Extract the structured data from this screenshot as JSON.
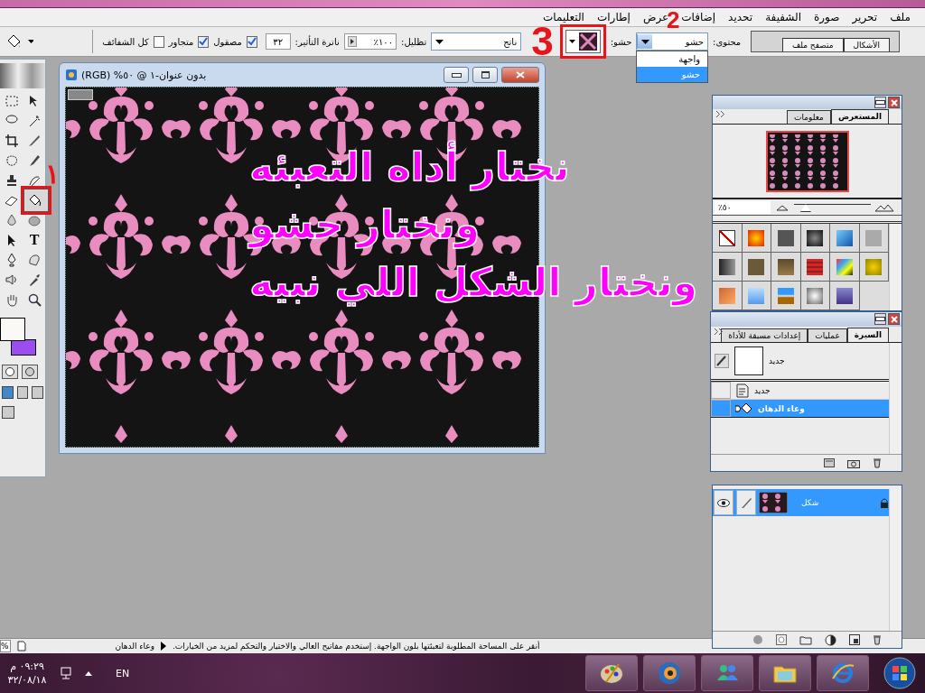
{
  "menu": [
    "ملف",
    "تحرير",
    "صورة",
    "الشفيفة",
    "تحديد",
    "إضافات",
    "عرض",
    "إطارات",
    "التعليمات"
  ],
  "options": {
    "well_tabs": [
      "الأشكال",
      "متصفح ملف"
    ],
    "content_label": "محتوى:",
    "content_value": "حشو",
    "content_options": [
      {
        "label": "واجهة",
        "selected": false
      },
      {
        "label": "حشو",
        "selected": true
      }
    ],
    "pattern_label": "حشو:",
    "mode_value": "ناتج",
    "opacity_label": "تظليل:",
    "opacity_value": "١٠٠٪",
    "tolerance_label": "ناترة التأثير:",
    "tolerance_value": "٣٢",
    "checkboxes": [
      {
        "label": "مصقول",
        "checked": true
      },
      {
        "label": "متجاور",
        "checked": true
      },
      {
        "label": "كل الشفائف",
        "checked": false
      }
    ]
  },
  "toolbox": {
    "tools": [
      {
        "kind": "marquee",
        "selected": false
      },
      {
        "kind": "move",
        "selected": false
      },
      {
        "kind": "lasso",
        "selected": false
      },
      {
        "kind": "wand",
        "selected": false
      },
      {
        "kind": "crop",
        "selected": false
      },
      {
        "kind": "knife",
        "selected": false
      },
      {
        "kind": "patch",
        "selected": false
      },
      {
        "kind": "brush",
        "selected": false
      },
      {
        "kind": "stamp",
        "selected": false
      },
      {
        "kind": "history",
        "selected": false
      },
      {
        "kind": "eraser",
        "selected": false
      },
      {
        "kind": "bucket",
        "selected": true
      },
      {
        "kind": "drop",
        "selected": false
      },
      {
        "kind": "sponge",
        "selected": false
      },
      {
        "kind": "pointer",
        "selected": false
      },
      {
        "kind": "type",
        "selected": false,
        "label": "T"
      },
      {
        "kind": "pen",
        "selected": false
      },
      {
        "kind": "shape",
        "selected": false
      },
      {
        "kind": "speaker",
        "selected": false
      },
      {
        "kind": "eyedropper",
        "selected": false
      },
      {
        "kind": "hand",
        "selected": false
      },
      {
        "kind": "zoom",
        "selected": false
      }
    ],
    "colors": [
      {
        "kind": "foreground",
        "color": "#faf9f6"
      },
      {
        "kind": "background",
        "color": "#9c4df0"
      }
    ]
  },
  "document": {
    "title": "بدون عنوان-١ @ ٥٠% (RGB)"
  },
  "annotations": {
    "markers": [
      "١",
      "2",
      "3"
    ],
    "lines": [
      "نختار أداه التعبئه",
      "ونختار حشو",
      "ونختار الشكل اللي نبيه"
    ]
  },
  "navigator": {
    "tabs": [
      {
        "label": "المستعرض",
        "selected": true
      },
      {
        "label": "معلومات",
        "selected": false
      }
    ],
    "zoom": "٥٠٪",
    "level": 0.14
  },
  "history": {
    "tabs": [
      {
        "label": "السيرة",
        "selected": true
      },
      {
        "label": "عمليات",
        "selected": false
      },
      {
        "label": "إعدادات مسبقة للأداة",
        "selected": false
      }
    ],
    "snapshot": "جديد",
    "steps": [
      {
        "label": "جديد",
        "kind": "open",
        "selected": false
      },
      {
        "label": "وعاء الدهان",
        "kind": "bucket",
        "selected": true
      }
    ]
  },
  "layers": [
    {
      "name": "شكل",
      "selected": true,
      "visible": true,
      "locked": true
    }
  ],
  "status": {
    "zoom": "%",
    "doc": "وعاء الدهان",
    "hint": "أنقر على المساحة المطلوبة لتعبئتها بلون الواجهة. إستخدم مفاتيح العالي والاختيار والتحكم لمزيد من الخيارات."
  },
  "taskbar": {
    "lang": "EN",
    "time": "٠٩:٢٩ م",
    "date": "٣٢/٠٨/١٨"
  }
}
